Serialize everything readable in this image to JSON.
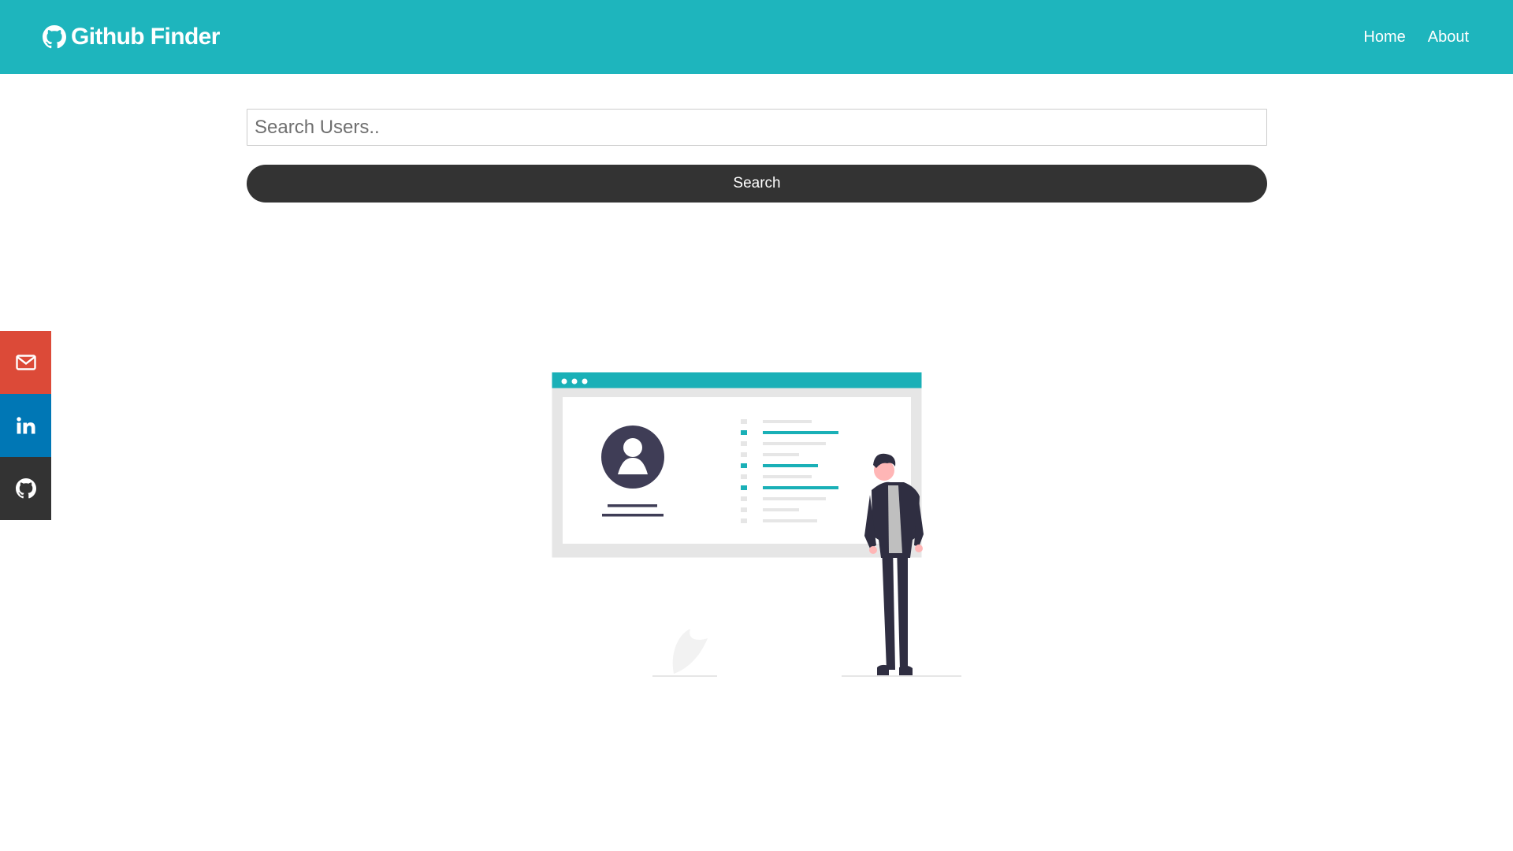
{
  "navbar": {
    "brand_icon": "github-icon",
    "brand_title": "Github Finder",
    "links": [
      {
        "label": "Home"
      },
      {
        "label": "About"
      }
    ],
    "background_color": "#1eb5bd"
  },
  "search": {
    "placeholder": "Search Users..",
    "value": "",
    "button_label": "Search"
  },
  "social_bar": {
    "items": [
      {
        "icon": "envelope-icon",
        "color": "#dc4a38"
      },
      {
        "icon": "linkedin-icon",
        "color": "#0077b5"
      },
      {
        "icon": "github-icon",
        "color": "#333333"
      }
    ]
  },
  "illustration": {
    "subject": "person-standing-by-profile-screen",
    "accent_color": "#1ab0b7"
  }
}
